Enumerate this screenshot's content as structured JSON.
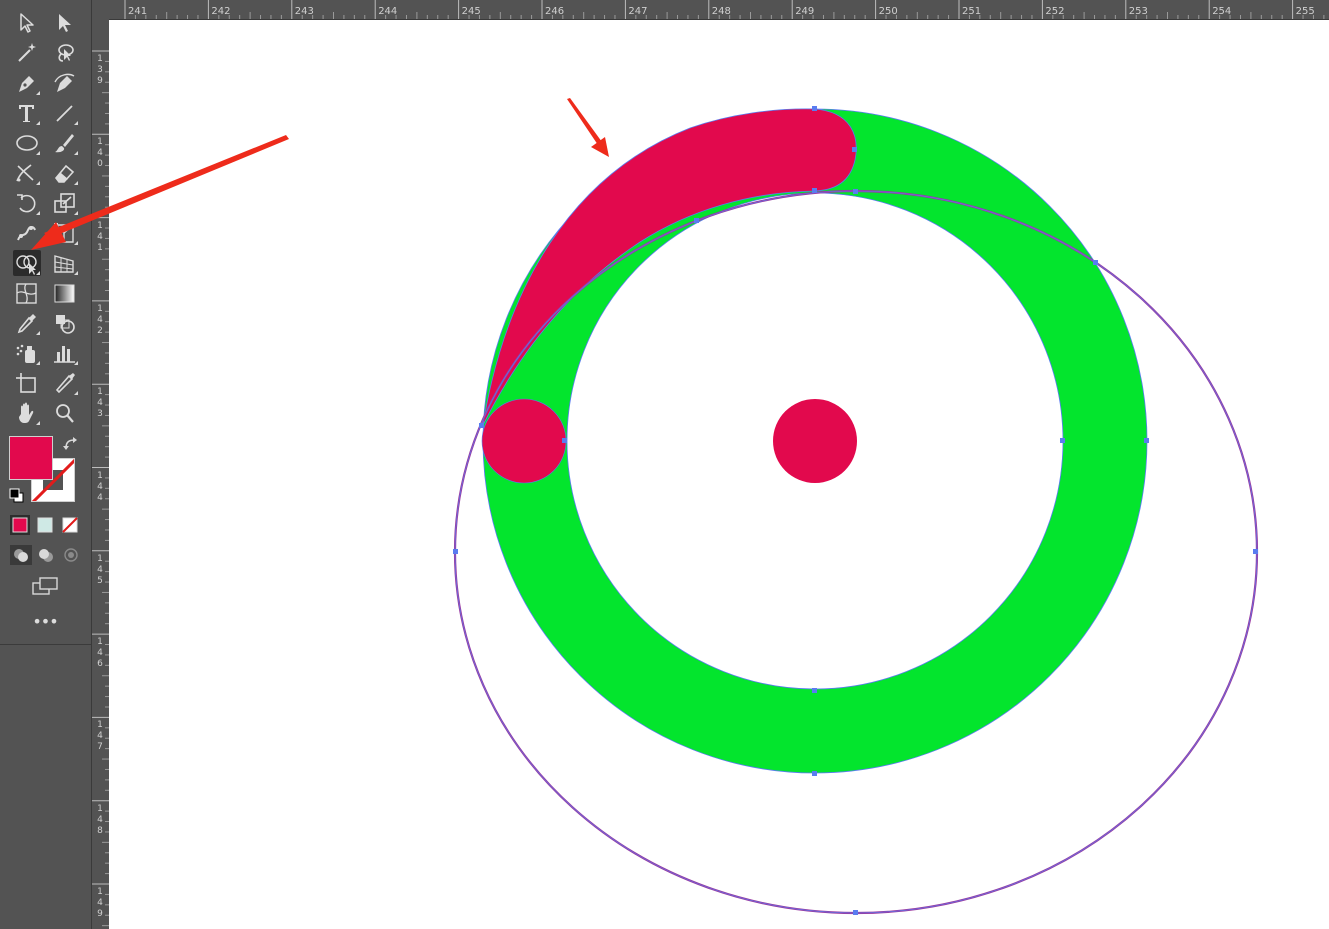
{
  "app": {
    "name": "Illustrator",
    "theme": "dark"
  },
  "toolbar": {
    "tools": [
      {
        "id": "selection-tool",
        "icon": "selection-arrow-icon",
        "has_flyout": false
      },
      {
        "id": "direct-selection-tool",
        "icon": "direct-selection-arrow-icon",
        "has_flyout": false
      },
      {
        "id": "magic-wand-tool",
        "icon": "magic-wand-icon",
        "has_flyout": false
      },
      {
        "id": "lasso-tool",
        "icon": "lasso-icon",
        "has_flyout": false
      },
      {
        "id": "pen-tool",
        "icon": "pen-icon",
        "has_flyout": true
      },
      {
        "id": "curvature-tool",
        "icon": "curvature-pen-icon",
        "has_flyout": false
      },
      {
        "id": "type-tool",
        "icon": "type-icon",
        "has_flyout": true
      },
      {
        "id": "line-segment-tool",
        "icon": "line-segment-icon",
        "has_flyout": true
      },
      {
        "id": "ellipse-tool",
        "icon": "ellipse-icon",
        "has_flyout": true
      },
      {
        "id": "paintbrush-tool",
        "icon": "paintbrush-icon",
        "has_flyout": true
      },
      {
        "id": "shaper-tool",
        "icon": "shaper-icon",
        "has_flyout": true
      },
      {
        "id": "eraser-tool",
        "icon": "eraser-icon",
        "has_flyout": true
      },
      {
        "id": "rotate-tool",
        "icon": "rotate-icon",
        "has_flyout": true
      },
      {
        "id": "scale-tool",
        "icon": "scale-icon",
        "has_flyout": true
      },
      {
        "id": "puppet-warp-tool",
        "icon": "puppet-warp-icon",
        "has_flyout": true
      },
      {
        "id": "free-transform-tool",
        "icon": "free-transform-icon",
        "has_flyout": true
      },
      {
        "id": "shape-builder-tool",
        "icon": "shape-builder-icon",
        "has_flyout": true,
        "selected": true
      },
      {
        "id": "perspective-grid-tool",
        "icon": "perspective-grid-icon",
        "has_flyout": true
      },
      {
        "id": "mesh-tool",
        "icon": "mesh-icon",
        "has_flyout": false
      },
      {
        "id": "gradient-tool",
        "icon": "gradient-icon",
        "has_flyout": false
      },
      {
        "id": "eyedropper-tool",
        "icon": "eyedropper-icon",
        "has_flyout": true
      },
      {
        "id": "blend-tool",
        "icon": "blend-icon",
        "has_flyout": false
      },
      {
        "id": "symbol-sprayer-tool",
        "icon": "symbol-sprayer-icon",
        "has_flyout": true
      },
      {
        "id": "column-graph-tool",
        "icon": "column-graph-icon",
        "has_flyout": true
      },
      {
        "id": "artboard-tool",
        "icon": "artboard-icon",
        "has_flyout": false
      },
      {
        "id": "slice-tool",
        "icon": "slice-icon",
        "has_flyout": true
      },
      {
        "id": "hand-tool",
        "icon": "hand-icon",
        "has_flyout": true
      },
      {
        "id": "zoom-tool",
        "icon": "zoom-icon",
        "has_flyout": false
      }
    ],
    "fill_color": "#e2094d",
    "stroke_color": "none",
    "more_label": "•••"
  },
  "rulers": {
    "horizontal_labels": [
      "241",
      "242",
      "243",
      "244",
      "245",
      "246",
      "247",
      "248",
      "249",
      "250",
      "251",
      "252",
      "253",
      "254",
      "255"
    ],
    "vertical_labels": [
      "139",
      "140",
      "141",
      "142",
      "143",
      "144",
      "145",
      "146",
      "147",
      "148",
      "149"
    ]
  },
  "artwork": {
    "ring_color": "#03e52d",
    "shape_color": "#e2094d",
    "ellipse_stroke": "#9a3aa0",
    "path_outline": "#5a7cf0",
    "annotation_arrow": "#ee2b1b"
  }
}
